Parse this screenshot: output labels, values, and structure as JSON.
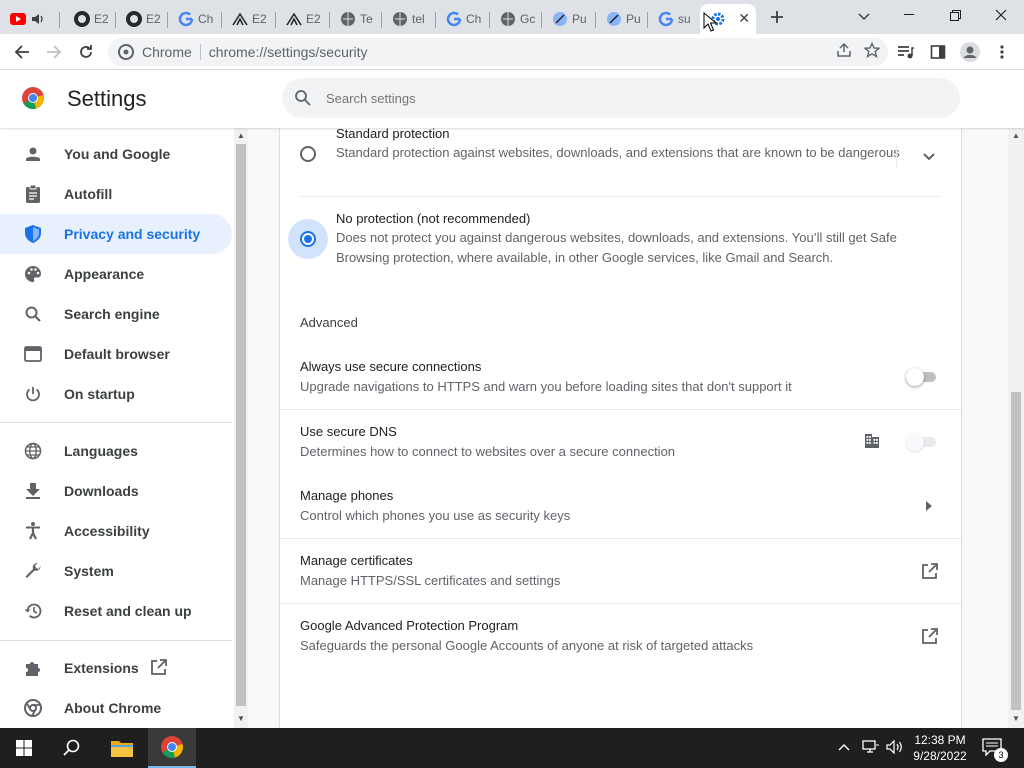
{
  "tabs": [
    {
      "title": "",
      "icon": "youtube-icon"
    },
    {
      "title": "E2",
      "icon": "github-icon"
    },
    {
      "title": "E2",
      "icon": "github-icon"
    },
    {
      "title": "Ch",
      "icon": "google-icon"
    },
    {
      "title": "E2",
      "icon": "tree-icon"
    },
    {
      "title": "E2",
      "icon": "tree-icon"
    },
    {
      "title": "Te",
      "icon": "globe-icon"
    },
    {
      "title": "tel",
      "icon": "globe-icon"
    },
    {
      "title": "Ch",
      "icon": "google-icon"
    },
    {
      "title": "Gc",
      "icon": "globe-icon"
    },
    {
      "title": "Pu",
      "icon": "puppeteer-icon"
    },
    {
      "title": "Pu",
      "icon": "puppeteer-icon"
    },
    {
      "title": "su",
      "icon": "google-icon"
    },
    {
      "title": "",
      "icon": "settings-gear-icon",
      "active": true
    }
  ],
  "omnibox": {
    "site": "Chrome",
    "url": "chrome://settings/security"
  },
  "header": {
    "title": "Settings",
    "search_placeholder": "Search settings"
  },
  "sidebar": {
    "items": [
      {
        "label": "You and Google",
        "icon": "person-icon"
      },
      {
        "label": "Autofill",
        "icon": "clipboard-icon"
      },
      {
        "label": "Privacy and security",
        "icon": "shield-icon",
        "selected": true
      },
      {
        "label": "Appearance",
        "icon": "palette-icon"
      },
      {
        "label": "Search engine",
        "icon": "search-icon"
      },
      {
        "label": "Default browser",
        "icon": "browser-window-icon"
      },
      {
        "label": "On startup",
        "icon": "power-icon"
      },
      {
        "label": "Languages",
        "icon": "globe-icon"
      },
      {
        "label": "Downloads",
        "icon": "download-icon"
      },
      {
        "label": "Accessibility",
        "icon": "accessibility-icon"
      },
      {
        "label": "System",
        "icon": "wrench-icon"
      },
      {
        "label": "Reset and clean up",
        "icon": "history-icon"
      },
      {
        "label": "Extensions",
        "icon": "puzzle-icon"
      },
      {
        "label": "About Chrome",
        "icon": "chrome-icon"
      }
    ]
  },
  "content": {
    "standard": {
      "title": "Standard protection",
      "desc": "Standard protection against websites, downloads, and extensions that are known to be dangerous"
    },
    "no_protection": {
      "title": "No protection (not recommended)",
      "desc": "Does not protect you against dangerous websites, downloads, and extensions. You’ll still get Safe Browsing protection, where available, in other Google services, like Gmail and Search."
    },
    "advanced_heading": "Advanced",
    "rows": [
      {
        "title": "Always use secure connections",
        "desc": "Upgrade navigations to HTTPS and warn you before loading sites that don't support it",
        "control": "toggle-off"
      },
      {
        "title": "Use secure DNS",
        "desc": "Determines how to connect to websites over a secure connection",
        "control": "toggle-disabled"
      },
      {
        "title": "Manage phones",
        "desc": "Control which phones you use as security keys",
        "control": "arrow"
      },
      {
        "title": "Manage certificates",
        "desc": "Manage HTTPS/SSL certificates and settings",
        "control": "external"
      },
      {
        "title": "Google Advanced Protection Program",
        "desc": "Safeguards the personal Google Accounts of anyone at risk of targeted attacks",
        "control": "external"
      }
    ]
  },
  "taskbar": {
    "time": "12:38 PM",
    "date": "9/28/2022",
    "notifications": "3"
  },
  "colors": {
    "accent": "#1a73e8",
    "selected_bg": "#e8f0fe",
    "tabstrip": "#dee1e6",
    "taskbar": "#1f1f1f"
  }
}
